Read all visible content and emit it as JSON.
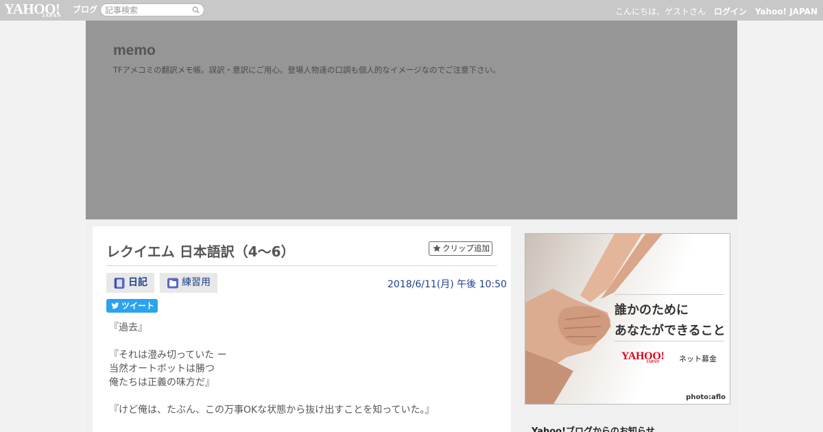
{
  "topbar": {
    "logo_main": "YAHOO!",
    "logo_sub": "JAPAN",
    "logo_blog": "ブログ",
    "search_placeholder": "記事検索",
    "greeting": "こんにちは、ゲストさん",
    "login": "ログイン",
    "yahoo_japan": "Yahoo! JAPAN"
  },
  "blog": {
    "title": "memo",
    "description": "TFアメコミの翻訳メモ帳。誤訳・意訳にご用心。登場人物達の口調も個人的なイメージなのでご注意下さい。"
  },
  "article": {
    "title": "レクイエム 日本語訳（4～6）",
    "clip_label": "クリップ追加",
    "category_diary": "日記",
    "category_folder": "練習用",
    "date": "2018/6/11(月) 午後 10:50",
    "tweet_label": "ツイート",
    "body": [
      "『過去』",
      "",
      "『それは澄み切っていた ー",
      "当然オートボットは勝つ",
      "俺たちは正義の味方だ』",
      "",
      "『けど俺は、たぶん、この万事OKな状態から抜け出すことを知っていた。』"
    ]
  },
  "ad": {
    "line1": "誰かのために",
    "line2": "あなたができること",
    "brand": "YAHOO!",
    "brand_sub": "JAPAN",
    "sub": "ネット募金",
    "credit": "photo:aflo"
  },
  "sidebar": {
    "notice_title": "Yahoo!ブログからのお知らせ"
  },
  "colors": {
    "topbar": "#c8c8c8",
    "banner": "#969696",
    "link": "#1d3f8a",
    "tweet": "#2aa3ef"
  }
}
